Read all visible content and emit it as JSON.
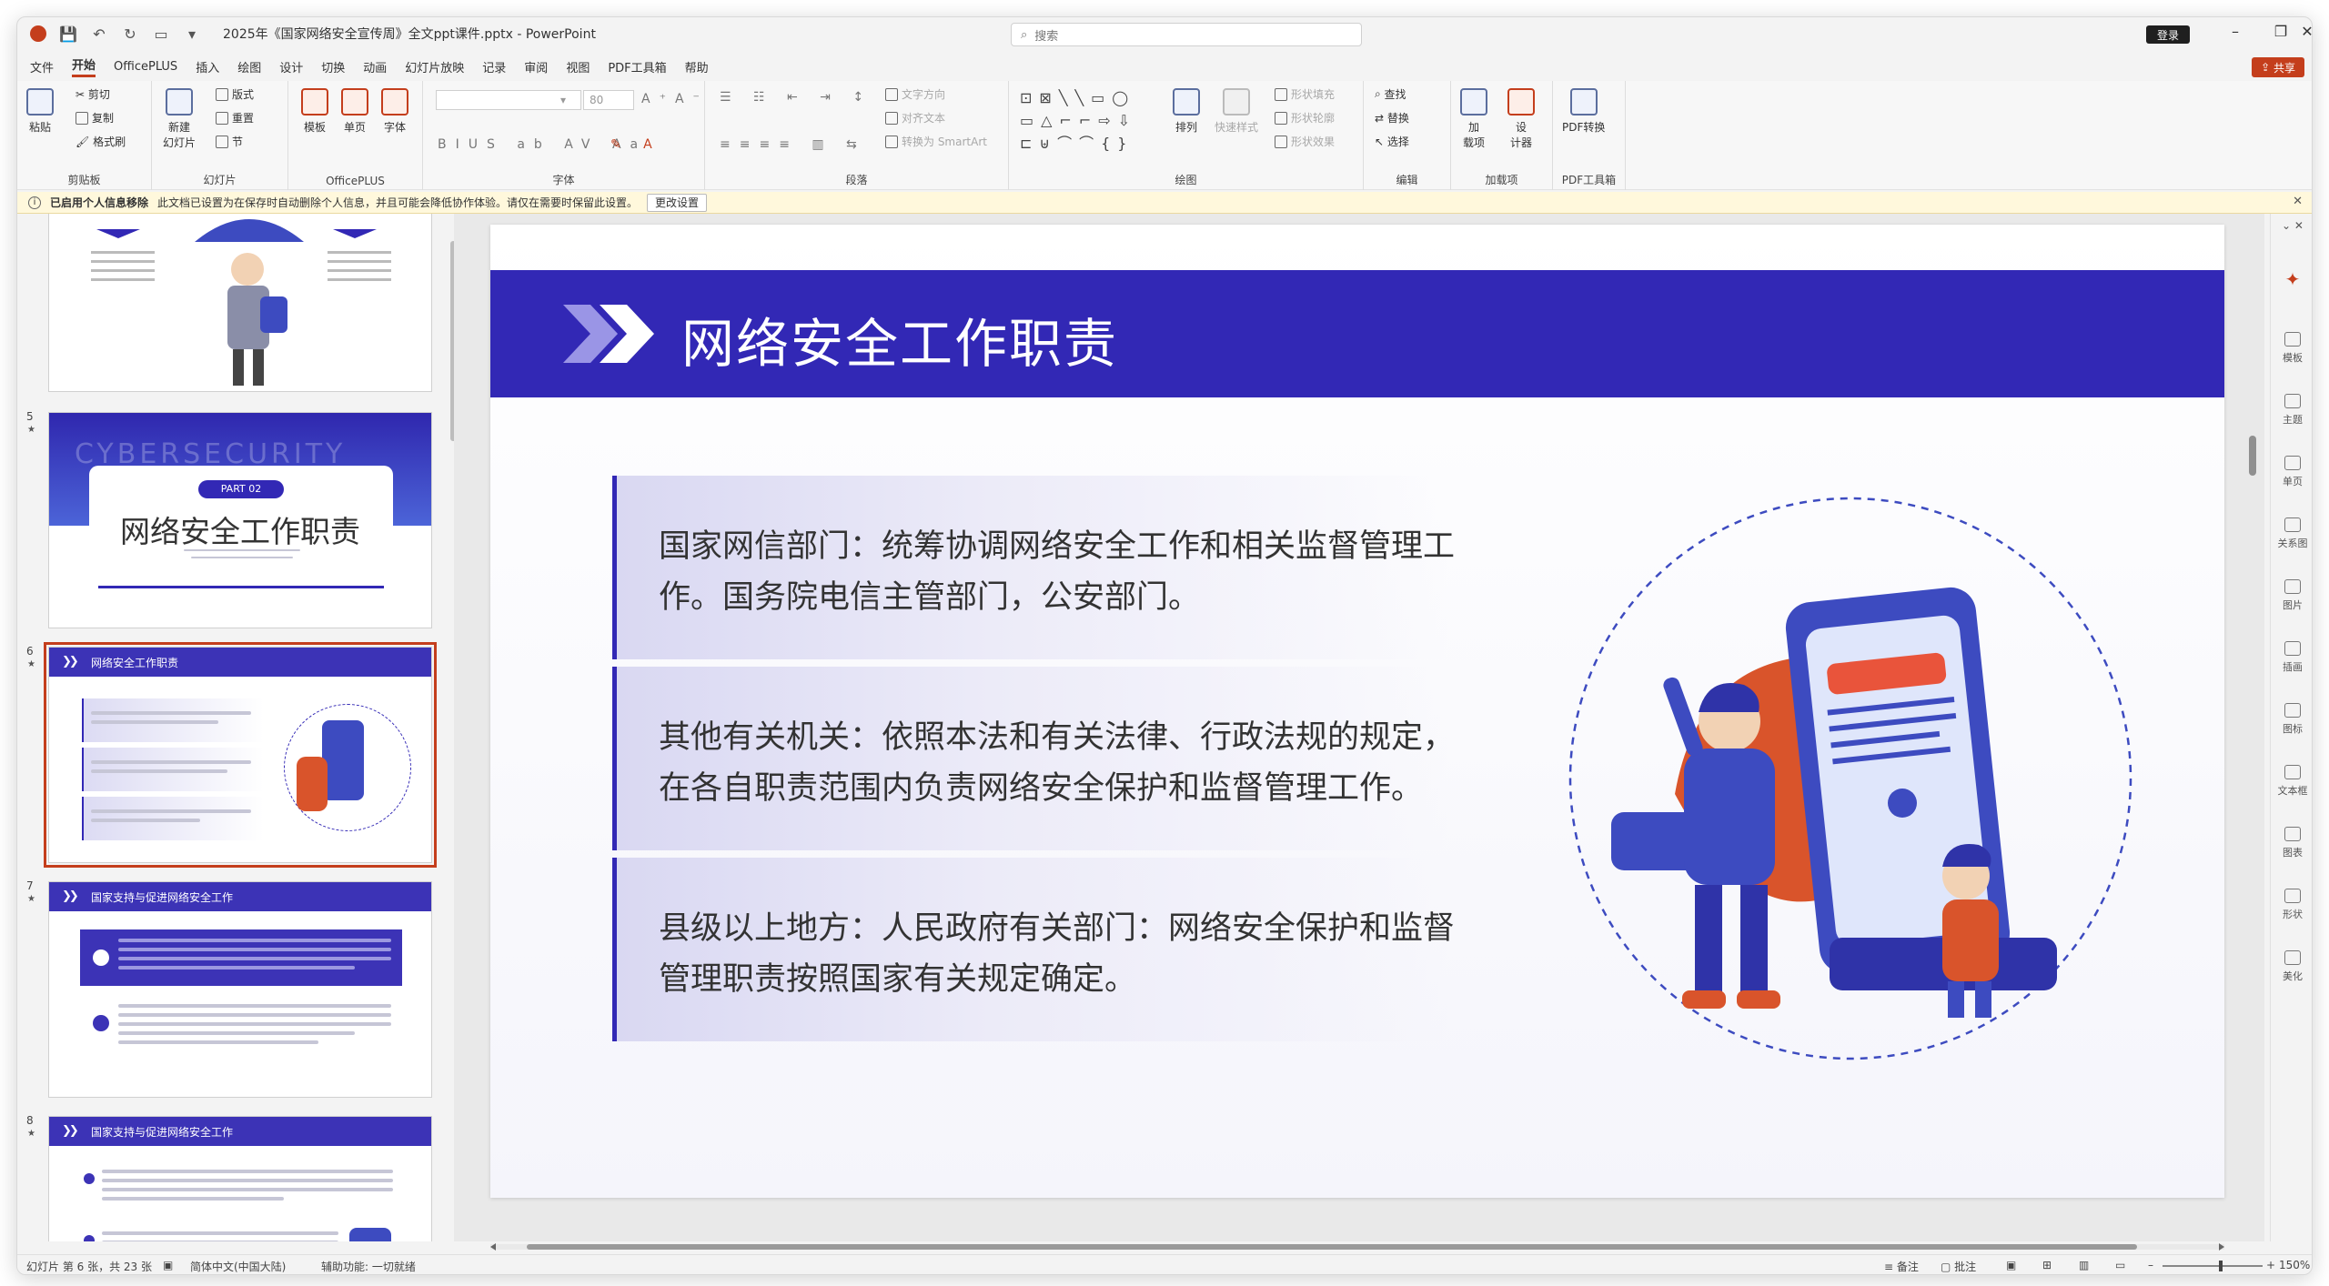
{
  "window": {
    "title": "2025年《国家网络安全宣传周》全文ppt课件.pptx  -  PowerPoint",
    "search_placeholder": "搜索",
    "login_label": "登录",
    "share_label": "共享"
  },
  "menu": [
    "文件",
    "开始",
    "OfficePLUS",
    "插入",
    "绘图",
    "设计",
    "切换",
    "动画",
    "幻灯片放映",
    "记录",
    "审阅",
    "视图",
    "PDF工具箱",
    "帮助"
  ],
  "ribbon": {
    "clipboard": {
      "paste": "粘贴",
      "cut": "剪切",
      "copy": "复制",
      "format_painter": "格式刷",
      "label": "剪贴板"
    },
    "slides": {
      "new_slide": "新建\n幻灯片",
      "layout": "版式",
      "reset": "重置",
      "section": "节",
      "label": "幻灯片"
    },
    "officeplus": {
      "template": "模板",
      "single_page": "单页",
      "font": "字体",
      "label": "OfficePLUS"
    },
    "font": {
      "font_size": "80",
      "label": "字体"
    },
    "paragraph": {
      "text_direction": "文字方向",
      "align_text": "对齐文本",
      "smartart": "转换为 SmartArt",
      "label": "段落"
    },
    "drawing": {
      "arrange": "排列",
      "quick_styles": "快速样式",
      "fill": "形状填充",
      "outline": "形状轮廓",
      "effects": "形状效果",
      "label": "绘图"
    },
    "editing": {
      "find": "查找",
      "replace": "替换",
      "select": "选择",
      "label": "编辑"
    },
    "addins": {
      "addins": "加\n载项",
      "designer": "设\n计器",
      "label": "加载项"
    },
    "pdf": {
      "convert": "PDF转换",
      "label": "PDF工具箱"
    }
  },
  "infobar": {
    "title": "已启用个人信息移除",
    "message": "此文档已设置为在保存时自动删除个人信息，并且可能会降低协作体验。请仅在需要时保留此设置。",
    "button": "更改设置"
  },
  "thumbnails": [
    {
      "number": "5",
      "title": "网络安全工作职责",
      "part": "PART 02",
      "watermark": "CYBERSECURITY"
    },
    {
      "number": "6",
      "title": "网络安全工作职责"
    },
    {
      "number": "7",
      "title": "国家支持与促进网络安全工作"
    },
    {
      "number": "8",
      "title": "国家支持与促进网络安全工作"
    }
  ],
  "slide": {
    "title": "网络安全工作职责",
    "items": [
      {
        "text": "国家网信部门：统筹协调网络安全工作和相关监督管理工作。国务院电信主管部门，公安部门。"
      },
      {
        "text": "其他有关机关：依照本法和有关法律、行政法规的规定，在各自职责范围内负责网络安全保护和监督管理工作。"
      },
      {
        "text": "县级以上地方：人民政府有关部门：网络安全保护和监督管理职责按照国家有关规定确定。"
      }
    ]
  },
  "rightpane": [
    "模板",
    "主题",
    "单页",
    "关系图",
    "图片",
    "插画",
    "图标",
    "文本框",
    "图表",
    "形状",
    "美化"
  ],
  "status": {
    "slide_info": "幻灯片 第 6 张，共 23 张",
    "language": "简体中文(中国大陆)",
    "accessibility": "辅助功能: 一切就绪",
    "notes": "备注",
    "comments": "批注",
    "zoom": "150%"
  },
  "colors": {
    "accent": "#3228b5",
    "app_red": "#c43e1c"
  }
}
